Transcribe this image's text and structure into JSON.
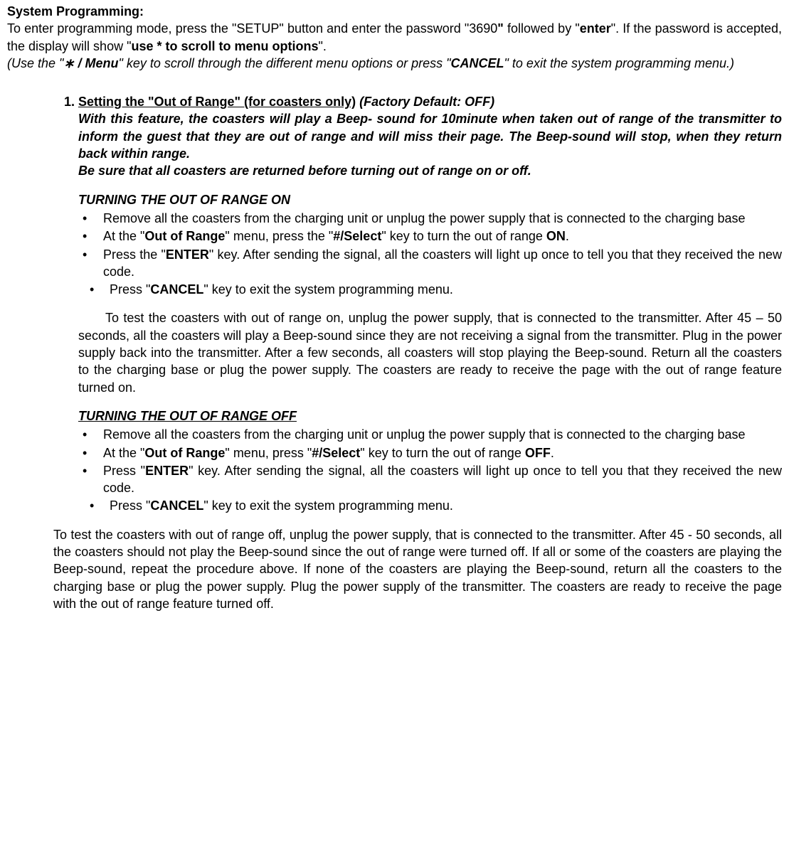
{
  "heading": "System Programming:",
  "intro": {
    "p1a": "To enter programming mode, press the \"SETUP\" button and enter the password \"3690",
    "p1b": "\"",
    "p1c": " followed by \"",
    "p1_enter": "enter",
    "p1d": "\".    If the password is accepted, the display will show \"",
    "p1_use": "use * to scroll to menu options",
    "p1e": "\".",
    "p2a": " (Use the   \"",
    "p2_star": "∗ / Menu",
    "p2b": "\" key to scroll through the different menu options or press \"",
    "p2_cancel": "CANCEL",
    "p2c": "\" to exit the system programming menu.)"
  },
  "item1": {
    "title": "Setting the \"Out of Range\" (for coasters only)",
    "spacer": "      ",
    "factory": "(Factory Default: OFF)",
    "desc1": "With this feature, the coasters will play a Beep- sound for 10minute when taken out of range of the transmitter to inform the guest that they are out of range and will miss their page. The Beep-sound will stop, when they return back within range.",
    "desc2": "Be sure that all coasters are returned before turning out of range on or off.",
    "on": {
      "header": "TURNING THE OUT OF RANGE ON",
      "b1": "Remove all the coasters from the charging unit or unplug the power supply that is connected to the charging base",
      "b2a": "At the \"",
      "b2_oor": "Out of Range",
      "b2b": "\" menu, press the \"",
      "b2_sel": "#/Select",
      "b2c": "\" key to turn the out of range ",
      "b2_on": "ON",
      "b2d": ".",
      "b3a": "Press the \"",
      "b3_enter": "ENTER",
      "b3b": "\" key. After sending the signal, all the coasters will light up once to tell you that they received the new code.",
      "b4a": "Press \"",
      "b4_cancel": "CANCEL",
      "b4b": "\" key to exit the system programming menu.",
      "test": "To test the coasters with out of range on, unplug the power supply, that is connected to the transmitter.   After 45 – 50 seconds, all the coasters will play a Beep-sound since they are not receiving a signal from the transmitter.   Plug in the power supply back into the transmitter.   After a few seconds, all coasters will stop playing the Beep-sound. Return all the coasters to the charging base or plug the power supply.    The coasters are ready to receive the page with the out of range feature turned on."
    },
    "off": {
      "header": "TURNING THE OUT OF RANGE OFF   ",
      "b1": "Remove all the coasters from the charging unit or unplug the power supply that is connected to the charging base",
      "b2a": "At the \"",
      "b2_oor": "Out of Range",
      "b2b": "\" menu, press \"",
      "b2_sel": "#/Select",
      "b2c": "\" key to turn the out of range ",
      "b2_off": "OFF",
      "b2d": ".",
      "b3a": "Press \"",
      "b3_enter": "ENTER",
      "b3b": "\" key. After sending the signal, all the coasters will light up once to tell you that they received the new code.",
      "b4a": "Press \"",
      "b4_cancel": "CANCEL",
      "b4b": "\" key to exit the system programming menu.",
      "test": "To test the coasters with out of range off, unplug the power supply, that is connected to the transmitter.    After 45 - 50 seconds, all the coasters should not play the Beep-sound since the out of range were turned off.   If all or some of the coasters are playing the Beep-sound, repeat the procedure above.   If none of the coasters are playing the Beep-sound, return all the coasters to the charging base or plug the power supply.   Plug the power supply of the transmitter.    The coasters are ready to receive the page with the out of range feature turned off."
    }
  }
}
